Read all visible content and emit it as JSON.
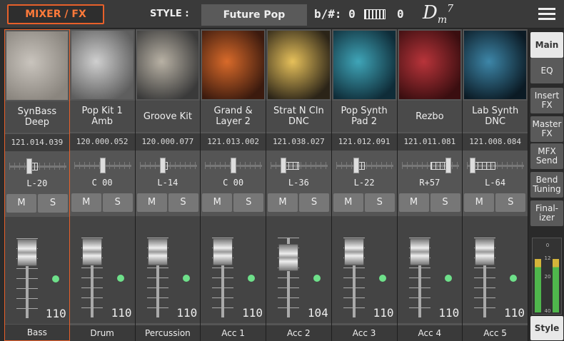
{
  "header": {
    "mixer_label": "MIXER / FX",
    "style_label": "STYLE :",
    "style_name": "Future Pop",
    "keysig_label": "b/#: 0",
    "transpose_value": "0",
    "chord_root": "D",
    "chord_minor": "m",
    "chord_ext": "7"
  },
  "channels": [
    {
      "name": "SynBass Deep",
      "id": "121.014.039",
      "pan": "L-20",
      "pan_pos": 0.34,
      "volume": "110",
      "label": "Bass",
      "thumb": "drum-machine",
      "colors": [
        "#c9c4bd",
        "#8a857e"
      ]
    },
    {
      "name": "Pop Kit 1 Amb",
      "id": "120.000.052",
      "pan": "C 00",
      "pan_pos": 0.5,
      "volume": "110",
      "label": "Drum",
      "thumb": "drum-kit",
      "colors": [
        "#cfcfcf",
        "#5e5e5e"
      ]
    },
    {
      "name": "Groove Kit",
      "id": "120.000.077",
      "pan": "L-14",
      "pan_pos": 0.39,
      "volume": "110",
      "label": "Percussion",
      "thumb": "groovebox",
      "colors": [
        "#b8b1a4",
        "#3a3a3a"
      ]
    },
    {
      "name": "Grand & Layer 2",
      "id": "121.013.002",
      "pan": "C 00",
      "pan_pos": 0.5,
      "volume": "110",
      "label": "Acc 1",
      "thumb": "piano",
      "colors": [
        "#d86a2a",
        "#3b1a0e"
      ]
    },
    {
      "name": "Strat N Cln DNC",
      "id": "121.038.027",
      "pan": "L-36",
      "pan_pos": 0.2,
      "volume": "104",
      "label": "Acc 2",
      "thumb": "guitar",
      "colors": [
        "#e6c05a",
        "#2b2418"
      ]
    },
    {
      "name": "Pop Synth Pad 2",
      "id": "121.012.091",
      "pan": "L-22",
      "pan_pos": 0.33,
      "volume": "110",
      "label": "Acc 3",
      "thumb": "synth",
      "colors": [
        "#3fa5b8",
        "#0f2c38"
      ]
    },
    {
      "name": "Rezbo",
      "id": "121.011.081",
      "pan": "R+57",
      "pan_pos": 0.85,
      "volume": "110",
      "label": "Acc 4",
      "thumb": "keyboard-red",
      "colors": [
        "#b8343a",
        "#3a0e10"
      ]
    },
    {
      "name": "Lab Synth DNC",
      "id": "121.008.084",
      "pan": "L-64",
      "pan_pos": 0.05,
      "volume": "110",
      "label": "Acc 5",
      "thumb": "modular",
      "colors": [
        "#3d86a8",
        "#0b1a24"
      ]
    }
  ],
  "fader_levels": [
    0.92,
    0.92,
    0.92,
    0.92,
    0.85,
    0.92,
    0.92,
    0.92
  ],
  "ms_labels": {
    "mute": "M",
    "solo": "S"
  },
  "sidebar": [
    {
      "label": "Main",
      "active": true
    },
    {
      "label": "EQ",
      "active": false
    },
    {
      "label": "Insert FX",
      "active": false
    },
    {
      "label": "Master FX",
      "active": false
    },
    {
      "label": "MFX Send",
      "active": false
    },
    {
      "label": "Bend Tuning",
      "active": false
    },
    {
      "label": "Final-izer",
      "active": false
    },
    {
      "label": "Style",
      "active": true
    }
  ],
  "meter": {
    "scale": [
      "0",
      "12",
      "20",
      "40"
    ],
    "levels": [
      0.75,
      0.75
    ]
  }
}
